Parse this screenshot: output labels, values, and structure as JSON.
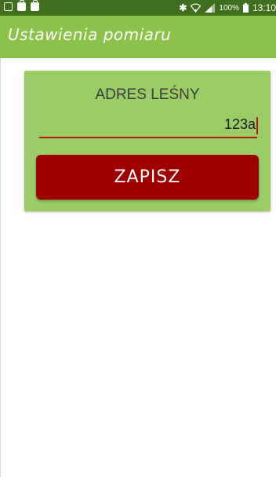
{
  "status_bar": {
    "battery": "100%",
    "time": "13:10",
    "icons": [
      "gallery-icon",
      "bag-icon",
      "bag-icon",
      "bluetooth-icon",
      "wifi-icon",
      "signal-icon",
      "battery-icon"
    ]
  },
  "app_bar": {
    "title": "Ustawienia pomiaru"
  },
  "form": {
    "label": "ADRES LEŚNY",
    "value": "123a",
    "save_label": "ZAPISZ"
  },
  "colors": {
    "status_bar": "#3f6e1f",
    "app_bar": "#8bc34a",
    "card": "#9ccc65",
    "button": "#9e0000",
    "underline": "#b01818"
  }
}
